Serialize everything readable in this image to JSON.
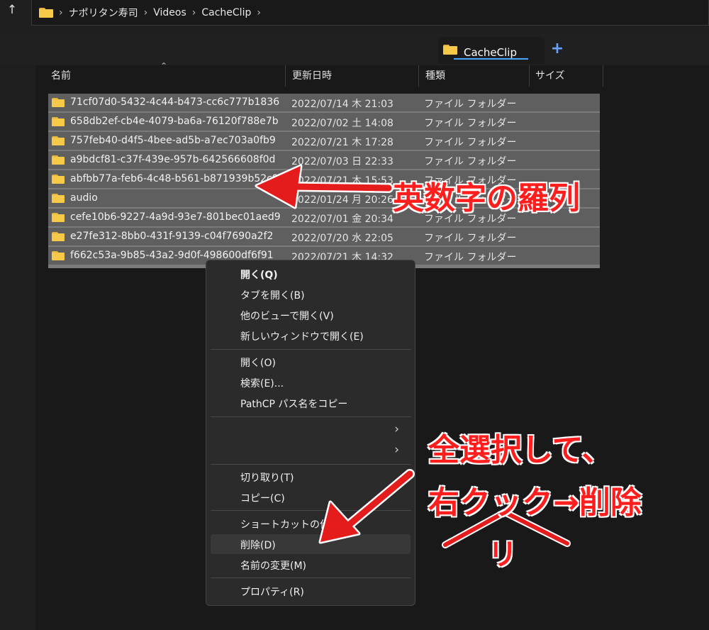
{
  "nav": {
    "up_glyph": "↑"
  },
  "address_bar": {
    "crumbs": [
      {
        "label": "ナポリタン寿司"
      },
      {
        "label": "Videos"
      },
      {
        "label": "CacheClip"
      }
    ],
    "separator": "›"
  },
  "tab": {
    "label": "CacheClip",
    "new_tab_glyph": "+"
  },
  "columns": [
    {
      "label": "名前"
    },
    {
      "label": "更新日時"
    },
    {
      "label": "種類"
    },
    {
      "label": "サイズ"
    }
  ],
  "sort_glyph": "⌃",
  "files": [
    {
      "name": "71cf07d0-5432-4c44-b473-cc6c777b1836",
      "date": "2022/07/14 木 21:03",
      "type": "ファイル フォルダー"
    },
    {
      "name": "658db2ef-cb4e-4079-ba6a-76120f788e7b",
      "date": "2022/07/02 土 14:08",
      "type": "ファイル フォルダー"
    },
    {
      "name": "757feb40-d4f5-4bee-ad5b-a7ec703a0fb9",
      "date": "2022/07/21 木 17:28",
      "type": "ファイル フォルダー"
    },
    {
      "name": "a9bdcf81-c37f-439e-957b-642566608f0d",
      "date": "2022/07/03 日 22:33",
      "type": "ファイル フォルダー"
    },
    {
      "name": "abfbb77a-feb6-4c48-b561-b871939b52c9",
      "date": "2022/07/21 木 15:53",
      "type": "ファイル フォルダー"
    },
    {
      "name": "audio",
      "date": "2022/01/24 月 20:26",
      "type": "ファイル フォルダー"
    },
    {
      "name": "cefe10b6-9227-4a9d-93e7-801bec01aed9",
      "date": "2022/07/01 金 20:34",
      "type": "ファイル フォルダー"
    },
    {
      "name": "e27fe312-8bb0-431f-9139-c04f7690a2f2",
      "date": "2022/07/20 水 22:05",
      "type": "ファイル フォルダー"
    },
    {
      "name": "f662c53a-9b85-43a2-9d0f-498600df6f91",
      "date": "2022/07/21 木 14:32",
      "type": "ファイル フォルダー"
    }
  ],
  "context_menu": {
    "open_bold": "開く(Q)",
    "open_tab": "タブを開く(B)",
    "open_other_view": "他のビューで開く(V)",
    "open_new_window": "新しいウィンドウで開く(E)",
    "open": "開く(O)",
    "search": "検索(E)...",
    "pathcp": "PathCP パス名をコピー",
    "submenu_glyph": "›",
    "cut": "切り取り(T)",
    "copy": "コピー(C)",
    "shortcut": "ショートカットの作成(S)",
    "delete": "削除(D)",
    "rename": "名前の変更(M)",
    "properties": "プロパティ(R)"
  },
  "annotations": {
    "random_chars": "英数字の羅列",
    "select_all": "全選択して、",
    "right_click": "右クック→削除",
    "ri": "リ"
  },
  "colors": {
    "annotation": "#ff1e1e",
    "folder": "#f7c948",
    "tab_underline": "#4aa6ff",
    "new_tab_plus": "#6aa0ff"
  }
}
